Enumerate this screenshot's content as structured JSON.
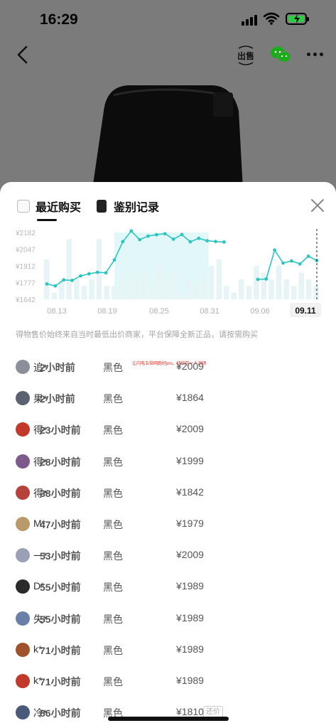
{
  "status": {
    "time": "16:29"
  },
  "nav": {
    "sell_label": "出售"
  },
  "tabs": [
    {
      "label": "最近购买"
    },
    {
      "label": "鉴别记录"
    }
  ],
  "colors": {
    "accent": "#2ec5c1",
    "bar": "#e6f4f6",
    "highlight": "#bfeeed"
  },
  "chart_data": {
    "type": "line",
    "y_ticks": [
      "¥2182",
      "¥2047",
      "¥1912",
      "¥1777",
      "¥1642"
    ],
    "ylim": [
      1642,
      2182
    ],
    "x_ticks": [
      "08.13",
      "08.19",
      "08.25",
      "08.31",
      "09.06",
      "09.11"
    ],
    "selected_x": "09.11",
    "series": [
      {
        "values": [
          1766,
          1750,
          1799,
          1795,
          1831,
          1848,
          1860,
          1856,
          1960,
          2108,
          2194,
          2124,
          2153,
          2164,
          2172,
          2128,
          2165,
          2107,
          2135,
          2115,
          2109,
          2105,
          null,
          null,
          null,
          1803,
          1806,
          2040,
          1935,
          1952,
          1928,
          1990,
          1955
        ]
      }
    ],
    "volume": [
      6,
      1,
      3,
      9,
      3,
      2,
      3,
      9,
      2,
      2,
      4,
      3,
      3,
      4,
      2,
      5,
      3,
      4,
      1,
      3,
      2,
      4,
      5,
      6,
      2,
      1,
      3,
      2,
      5,
      4,
      3,
      5,
      3,
      2,
      4,
      3,
      2
    ]
  },
  "note": "得物售价始终来自当时最低出价商家，平台保障全新正品，请按需购买",
  "watermark": "让闪电五倍网跑好pro，纽约区一人测场",
  "records": [
    {
      "name": "追*",
      "color": "黑色",
      "price": "¥2009",
      "time": "2小时前",
      "avatar_color": "#8a8f99"
    },
    {
      "name": "果*",
      "color": "黑色",
      "price": "¥1864",
      "time": "2小时前",
      "avatar_color": "#5c6170"
    },
    {
      "name": "得*",
      "color": "黑色",
      "price": "¥2009",
      "time": "23小时前",
      "avatar_color": "#c0392b"
    },
    {
      "name": "得*",
      "color": "黑色",
      "price": "¥1999",
      "time": "28小时前",
      "avatar_color": "#7d5a8c"
    },
    {
      "name": "得*",
      "color": "黑色",
      "price": "¥1842",
      "time": "38小时前",
      "avatar_color": "#b5433b"
    },
    {
      "name": "M*",
      "color": "黑色",
      "price": "¥1979",
      "time": "47小时前",
      "avatar_color": "#b89a6a"
    },
    {
      "name": "一*",
      "color": "黑色",
      "price": "¥2009",
      "time": "53小时前",
      "avatar_color": "#9aa0b5"
    },
    {
      "name": "D*",
      "color": "黑色",
      "price": "¥1989",
      "time": "55小时前",
      "avatar_color": "#2b2b2b"
    },
    {
      "name": "失*",
      "color": "黑色",
      "price": "¥1989",
      "time": "55小时前",
      "avatar_color": "#6a7fa8"
    },
    {
      "name": "k*",
      "color": "黑色",
      "price": "¥1989",
      "time": "71小时前",
      "avatar_color": "#a0522d"
    },
    {
      "name": "k*",
      "color": "黑色",
      "price": "¥1989",
      "time": "71小时前",
      "avatar_color": "#c0392b"
    },
    {
      "name": "冷*",
      "color": "黑色",
      "price": "¥1810",
      "time": "86小时前",
      "avatar_color": "#4a5a7a",
      "tag": "还价"
    }
  ]
}
